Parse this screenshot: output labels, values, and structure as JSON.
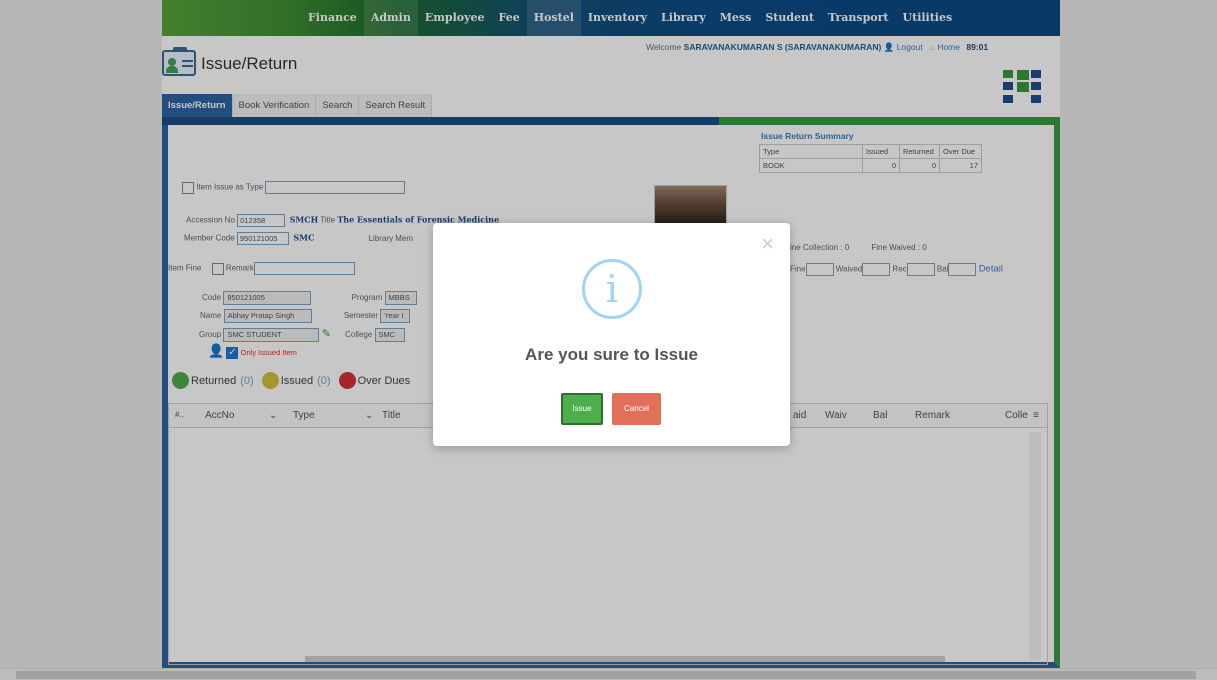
{
  "nav": [
    "Finance",
    "Admin",
    "Employee",
    "Fee",
    "Hostel",
    "Inventory",
    "Library",
    "Mess",
    "Student",
    "Transport",
    "Utilities"
  ],
  "header": {
    "welcome_prefix": "Welcome",
    "user": "SARAVANAKUMARAN S (SARAVANAKUMARAN)",
    "logout": "Logout",
    "home": "Home",
    "clock": "89:01",
    "page_title": "Issue/Return"
  },
  "tabs": [
    "Issue/Return",
    "Book Verification",
    "Search",
    "Search Result"
  ],
  "form": {
    "item_issue_as_type_label": "Item Issue as Type",
    "accession_label": "Accession No",
    "accession_value": "012358",
    "accession_lib": "SMCH",
    "title_label": "Title",
    "title_value": "The Essentials of Forensic Medicine",
    "member_code_label": "Member Code",
    "member_code_value": "950121005",
    "member_lib": "SMC",
    "library_label": "Library Mem",
    "item_fine_label": "Item Fine",
    "remark_label": "Remark",
    "code_label": "Code",
    "code_value": "950121005",
    "program_label": "Program",
    "program_value": "MBBS",
    "name_label": "Name",
    "name_value": "Abhay Pratap Singh",
    "semester_label": "Semester",
    "semester_value": "Year I",
    "group_label": "Group",
    "group_value": "SMC STUDENT",
    "college_label": "College",
    "college_value": "SMC",
    "only_issued_label": "Only Issued Item"
  },
  "summary": {
    "title": "Issue Return Summary",
    "headers": [
      "Type",
      "Issued",
      "Returned",
      "Over Due"
    ],
    "row": [
      "BOOK",
      "0",
      "0",
      "17"
    ]
  },
  "fine": {
    "collection_label": "ine Collection : 0",
    "waived_label": "Fine Waived : 0",
    "fine": "Fine",
    "waived": "Waived",
    "rec": "Rec",
    "bal": "Bal",
    "detail": "Detail"
  },
  "legend": {
    "returned_label": "Returned",
    "returned_count": "(0)",
    "issued_label": "Issued",
    "issued_count": "(0)",
    "overdue_label": "Over Dues"
  },
  "grid_columns": {
    "sno": "#..",
    "accno": "AccNo",
    "type": "Type",
    "title": "Title",
    "paid": "aid",
    "waiv": "Waiv",
    "bal": "Bal",
    "remark": "Remark",
    "colle": "Colle"
  },
  "dialog": {
    "message": "Are you sure to Issue",
    "confirm": "Issue",
    "cancel": "Cancel",
    "close_glyph": "×",
    "icon_glyph": "i"
  },
  "colors": {
    "nav_green": "#3f8e34",
    "nav_blue": "#0b4a84",
    "confirm_green": "#4fae4c",
    "cancel_red": "#e0705a",
    "info_blue": "#9fd4f3"
  }
}
